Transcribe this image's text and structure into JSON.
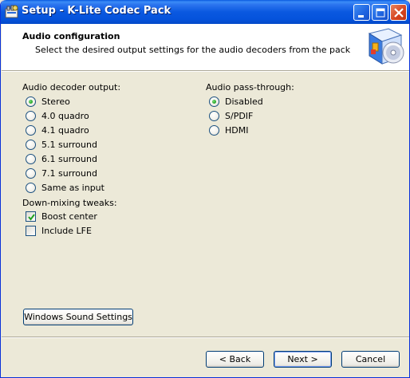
{
  "window": {
    "title": "Setup - K-Lite Codec Pack",
    "accent": "#0a58e0",
    "close_color": "#d5431e"
  },
  "header": {
    "title": "Audio configuration",
    "subtitle": "Select the desired output settings for the audio decoders from the pack",
    "logo_icon": "codec-pack-logo-icon"
  },
  "decoder_output": {
    "label": "Audio decoder output:",
    "options": [
      "Stereo",
      "4.0 quadro",
      "4.1 quadro",
      "5.1 surround",
      "6.1 surround",
      "7.1 surround",
      "Same as input"
    ],
    "selected": "Stereo"
  },
  "passthrough": {
    "label": "Audio pass-through:",
    "options": [
      "Disabled",
      "S/PDIF",
      "HDMI"
    ],
    "selected": "Disabled"
  },
  "downmix": {
    "label": "Down-mixing tweaks:",
    "boost_center": {
      "label": "Boost center",
      "checked": true
    },
    "include_lfe": {
      "label": "Include LFE",
      "checked": false
    }
  },
  "buttons": {
    "sound_settings": "Windows Sound Settings",
    "back": "< Back",
    "next": "Next >",
    "cancel": "Cancel"
  }
}
